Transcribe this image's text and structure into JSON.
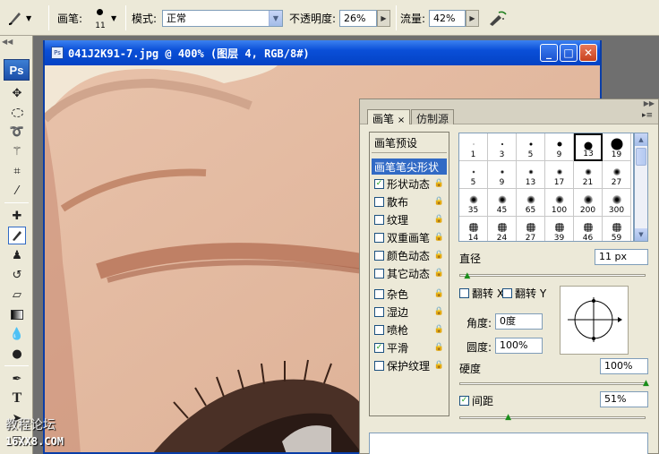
{
  "options_bar": {
    "brush_label": "画笔:",
    "brush_size": "11",
    "mode_label": "模式:",
    "mode_value": "正常",
    "opacity_label": "不透明度:",
    "opacity_value": "26%",
    "flow_label": "流量:",
    "flow_value": "42%"
  },
  "toolbar": {
    "logo": "Ps"
  },
  "document": {
    "title": "041J2K91-7.jpg @ 400% (图层 4, RGB/8#)",
    "icon_label": "Ps"
  },
  "brushes_panel": {
    "tabs": [
      {
        "label": "画笔",
        "close": "×"
      },
      {
        "label": "仿制源"
      }
    ],
    "preset_header": "画笔预设",
    "list_items": [
      {
        "label": "画笔笔尖形状",
        "checkbox": false,
        "selected": true
      },
      {
        "label": "形状动态",
        "checked": true,
        "checkbox": true
      },
      {
        "label": "散布",
        "checked": false,
        "checkbox": true
      },
      {
        "label": "纹理",
        "checked": false,
        "checkbox": true
      },
      {
        "label": "双重画笔",
        "checked": false,
        "checkbox": true
      },
      {
        "label": "颜色动态",
        "checked": false,
        "checkbox": true
      },
      {
        "label": "其它动态",
        "checked": false,
        "checkbox": true
      },
      {
        "label": "杂色",
        "checked": false,
        "checkbox": true
      },
      {
        "label": "湿边",
        "checked": false,
        "checkbox": true
      },
      {
        "label": "喷枪",
        "checked": false,
        "checkbox": true
      },
      {
        "label": "平滑",
        "checked": true,
        "checkbox": true
      },
      {
        "label": "保护纹理",
        "checked": false,
        "checkbox": true
      }
    ],
    "brush_tips": [
      [
        "1",
        "3",
        "5",
        "9",
        "13",
        "19"
      ],
      [
        "5",
        "9",
        "13",
        "17",
        "21",
        "27"
      ],
      [
        "35",
        "45",
        "65",
        "100",
        "200",
        "300"
      ],
      [
        "14",
        "24",
        "27",
        "39",
        "46",
        "59"
      ]
    ],
    "selected_tip": "13",
    "diameter_label": "直径",
    "diameter_value": "11 px",
    "flip_x_label": "翻转 X",
    "flip_y_label": "翻转 Y",
    "angle_label": "角度:",
    "angle_value": "0度",
    "roundness_label": "圆度:",
    "roundness_value": "100%",
    "hardness_label": "硬度",
    "hardness_value": "100%",
    "spacing_label": "间距",
    "spacing_checked": true,
    "spacing_value": "51%",
    "diameter_level": 0.04,
    "hardness_level": 1.0,
    "spacing_level": 0.26
  },
  "watermark": {
    "line1": "教程论坛",
    "line2": "16XX8.COM"
  }
}
